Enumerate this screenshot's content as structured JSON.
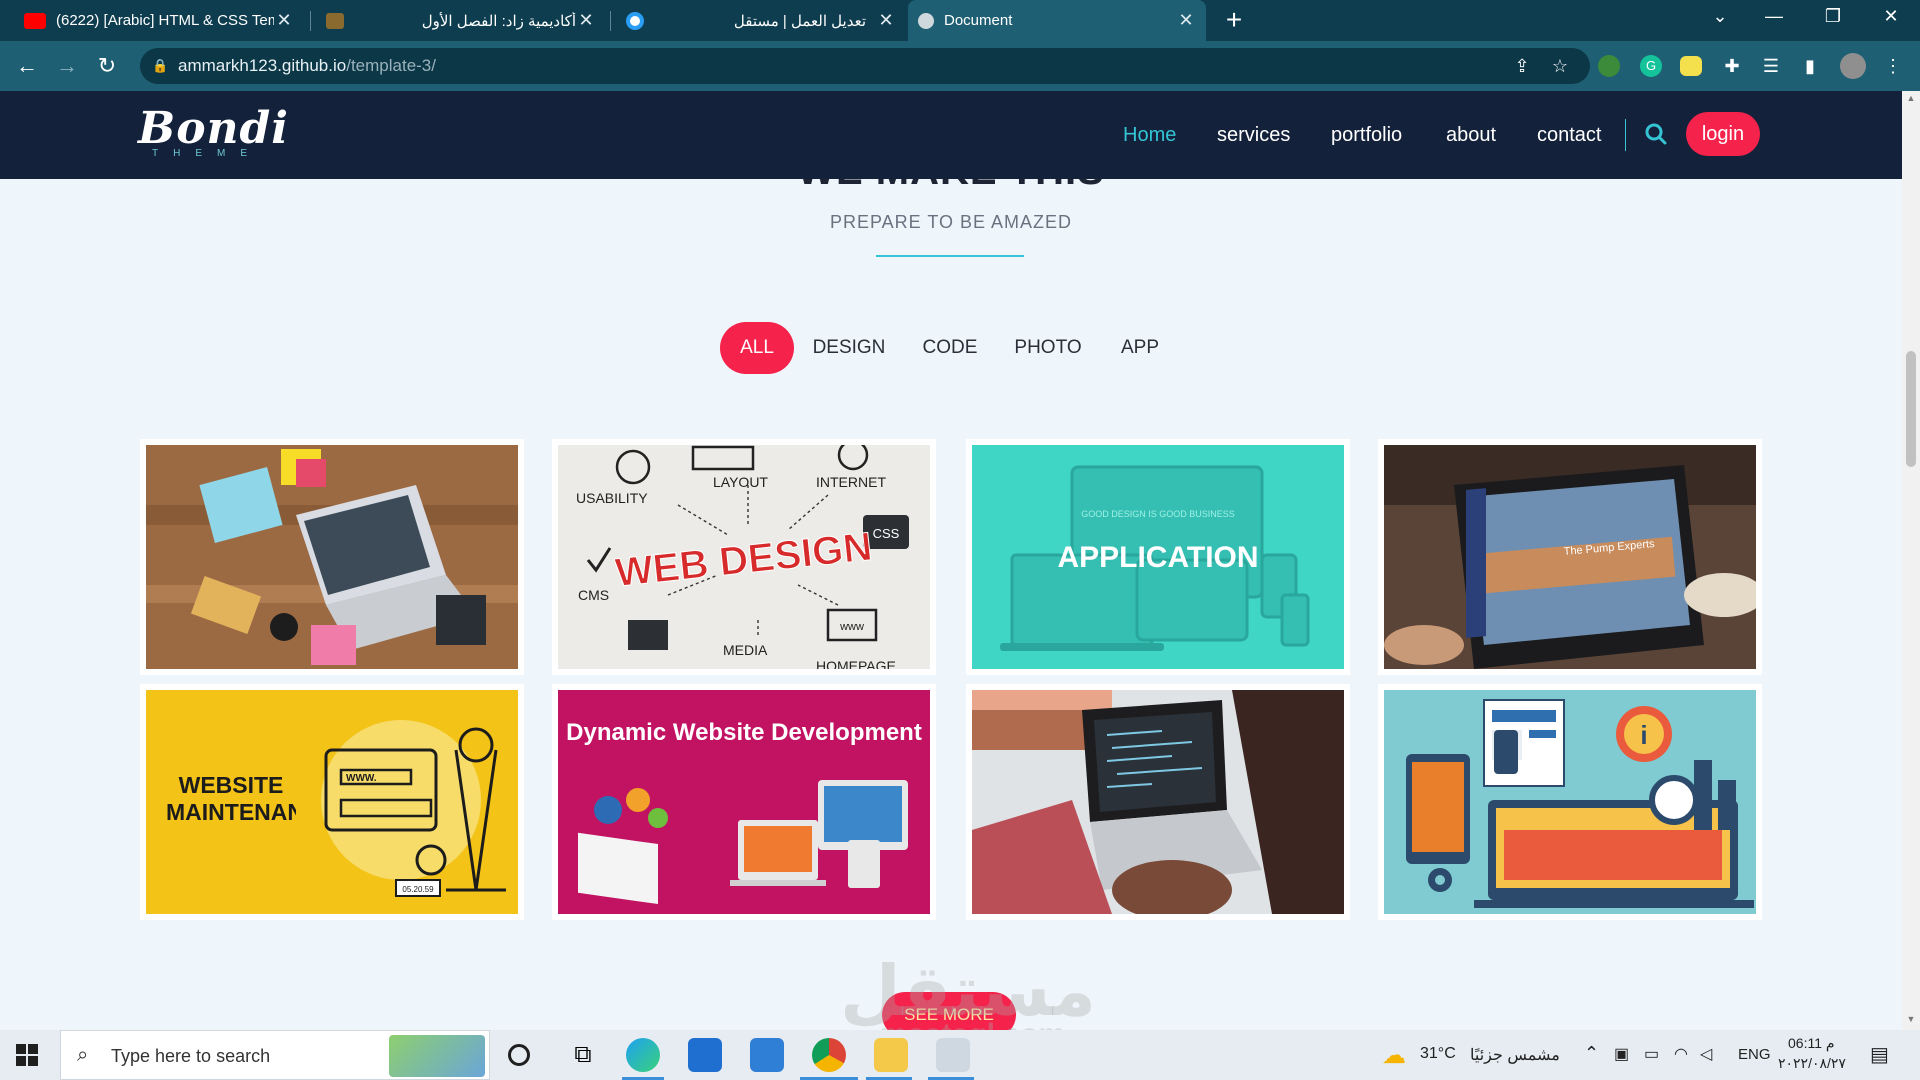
{
  "browser": {
    "tabs": [
      {
        "title": "(6222) [Arabic] HTML & CSS Tem",
        "active": false,
        "favicon_color": "#ff0000"
      },
      {
        "title": "",
        "active": false,
        "favicon_color": "#8a6a2e"
      },
      {
        "title": "أكاديمية زاد: الفصل الأول",
        "active": false,
        "favicon_color": ""
      },
      {
        "title": "تعديل العمل | مستقل",
        "active": false,
        "favicon_color": "#2a9df4"
      },
      {
        "title": "Document",
        "active": true,
        "favicon_color": "#cfd9dd"
      }
    ],
    "new_tab": "+",
    "url_domain": "ammarkh123.github.io",
    "url_path": "/template-3/"
  },
  "site": {
    "logo_text": "Bondi",
    "logo_sub": "THEME",
    "nav": [
      {
        "label": "Home",
        "active": true
      },
      {
        "label": "services",
        "active": false
      },
      {
        "label": "portfolio",
        "active": false
      },
      {
        "label": "about",
        "active": false
      },
      {
        "label": "contact",
        "active": false
      }
    ],
    "login_label": "login"
  },
  "portfolio": {
    "title": "WE MAKE THIS",
    "subtitle": "PREPARE TO BE AMAZED",
    "filters": [
      {
        "label": "ALL",
        "active": true
      },
      {
        "label": "DESIGN",
        "active": false
      },
      {
        "label": "CODE",
        "active": false
      },
      {
        "label": "PHOTO",
        "active": false
      },
      {
        "label": "APP",
        "active": false
      }
    ],
    "items": [
      {
        "name": "desk-workspace",
        "caption": ""
      },
      {
        "name": "web-design",
        "caption": "WEB DESIGN",
        "words": [
          "USABILITY",
          "LAYOUT",
          "INTERNET",
          "CSS",
          "CMS",
          "MEDIA",
          "HOMEPAGE"
        ]
      },
      {
        "name": "application",
        "caption": "APPLICATION",
        "small_text": "GOOD DESIGN IS GOOD BUSINESS"
      },
      {
        "name": "laptop-site",
        "caption": "The Pump Experts"
      },
      {
        "name": "website-maintenance",
        "caption": "WEBSITE MAINTENANCE",
        "small_text": "WWW.",
        "time": "05.20.59"
      },
      {
        "name": "dynamic-website",
        "caption": "Dynamic Website Development"
      },
      {
        "name": "coding-laptop",
        "caption": ""
      },
      {
        "name": "analytics-illustration",
        "caption": ""
      }
    ],
    "see_more_label": "SEE MORE"
  },
  "watermark": {
    "text": "مستقل",
    "sub": "mostaql.com"
  },
  "taskbar": {
    "search_placeholder": "Type here to search",
    "weather_temp": "31°C",
    "weather_text": "مشمس جزئيًا",
    "language": "ENG",
    "time": "06:11 م",
    "date": "٢٠٢٢/٠٨/٢٧"
  }
}
